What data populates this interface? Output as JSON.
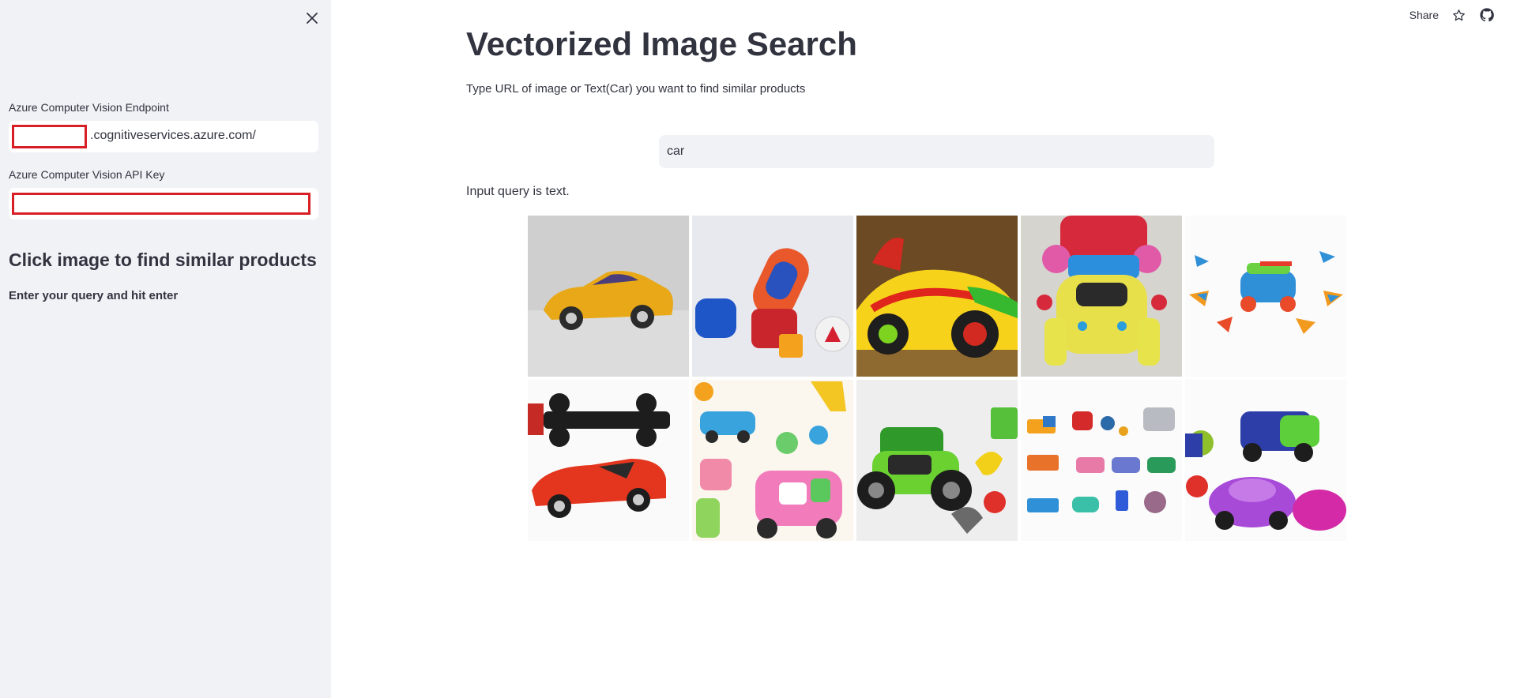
{
  "sidebar": {
    "endpoint_label": "Azure Computer Vision Endpoint",
    "endpoint_suffix": ".cognitiveservices.azure.com/",
    "api_key_label": "Azure Computer Vision API Key",
    "heading": "Click image to find similar products",
    "subheading": "Enter your query and hit enter",
    "close_icon": "close-icon"
  },
  "toolbar": {
    "share_label": "Share",
    "star_icon": "star-icon",
    "github_icon": "github-icon"
  },
  "main": {
    "title": "Vectorized Image Search",
    "description": "Type URL of image or Text(Car) you want to find similar products",
    "search_value": "car",
    "status": "Input query is text."
  },
  "results": [
    {
      "id": "yellow-sports-car"
    },
    {
      "id": "toy-cars-topdown"
    },
    {
      "id": "green-race-car"
    },
    {
      "id": "stacked-toy-cars"
    },
    {
      "id": "colorful-toy-planes"
    },
    {
      "id": "race-cars-red-black"
    },
    {
      "id": "cartoon-pink-car"
    },
    {
      "id": "green-toy-tractor"
    },
    {
      "id": "toy-cars-collection"
    },
    {
      "id": "purple-toy-cars"
    }
  ],
  "colors": {
    "sidebar_bg": "#f0f2f6",
    "text": "#31333f",
    "redaction": "#d81f26"
  }
}
